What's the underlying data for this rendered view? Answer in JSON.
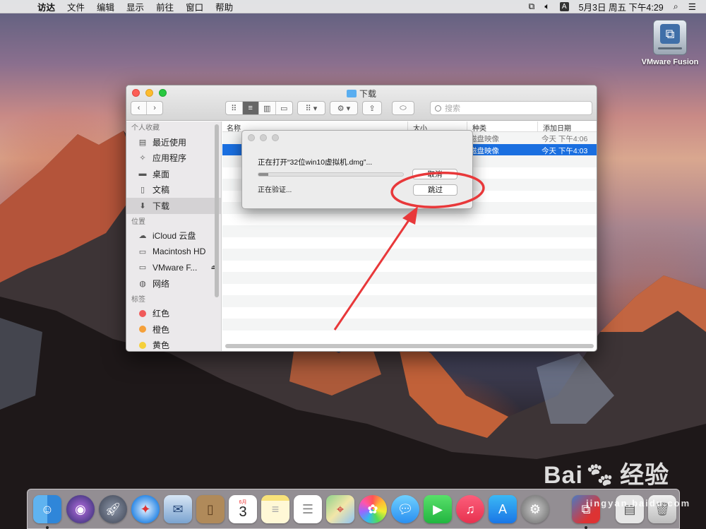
{
  "menubar": {
    "apple": "",
    "items": [
      "访达",
      "文件",
      "编辑",
      "显示",
      "前往",
      "窗口",
      "帮助"
    ],
    "input_indicator": "A",
    "datetime": "5月3日 周五 下午4:29"
  },
  "desktop_icon": {
    "label": "VMware Fusion",
    "icon": "vmware-drive-icon"
  },
  "finder": {
    "title": "下载",
    "search_placeholder": "搜索",
    "sidebar": {
      "favorites_header": "个人收藏",
      "favorites": [
        {
          "label": "最近使用",
          "icon": "clock-icon"
        },
        {
          "label": "应用程序",
          "icon": "apps-icon"
        },
        {
          "label": "桌面",
          "icon": "desktop-icon"
        },
        {
          "label": "文稿",
          "icon": "document-icon"
        },
        {
          "label": "下载",
          "icon": "download-icon"
        }
      ],
      "locations_header": "位置",
      "locations": [
        {
          "label": "iCloud 云盘",
          "icon": "cloud-icon"
        },
        {
          "label": "Macintosh HD",
          "icon": "disk-icon"
        },
        {
          "label": "VMware F...",
          "icon": "disk-icon"
        },
        {
          "label": "网络",
          "icon": "globe-icon"
        }
      ],
      "tags_header": "标签",
      "tags": [
        {
          "label": "红色",
          "color": "#f05a5a"
        },
        {
          "label": "橙色",
          "color": "#f5a03a"
        },
        {
          "label": "黄色",
          "color": "#f5d03a"
        }
      ]
    },
    "columns": {
      "name": "名称",
      "size": "大小",
      "kind": "种类",
      "date": "添加日期"
    },
    "rows": [
      {
        "kind": "磁盘映像",
        "date": "今天 下午4:06"
      },
      {
        "kind": "磁盘映像",
        "date": "今天 下午4:03"
      }
    ]
  },
  "dialog": {
    "title": "正在打开“32位win10虚拟机.dmg”...",
    "status": "正在验证...",
    "progress": 0.07,
    "cancel_label": "取消",
    "skip_label": "跳过"
  },
  "dock": {
    "icons": [
      "finder-icon",
      "siri-icon",
      "launchpad-icon",
      "safari-icon",
      "mail-icon",
      "contacts-icon",
      "calendar-icon",
      "notes-icon",
      "reminders-icon",
      "maps-icon",
      "photos-icon",
      "messages-icon",
      "facetime-icon",
      "music-icon",
      "appstore-icon",
      "settings-icon",
      "vmware-icon",
      "preview-icon",
      "trash-icon"
    ],
    "calendar_day": "3",
    "calendar_month": "6月"
  },
  "watermark": {
    "brand": "Bai",
    "cn": "经验",
    "url": "jingyan.baidu.com"
  }
}
